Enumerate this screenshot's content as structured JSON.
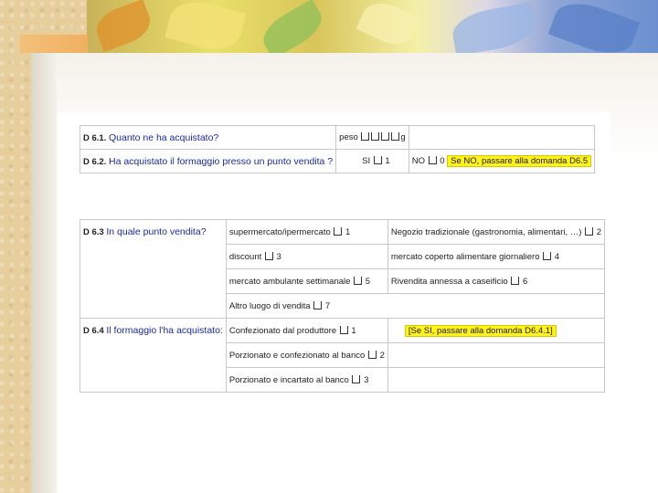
{
  "d61": {
    "code": "D 6.1.",
    "question": "Quanto ne ha acquistato?",
    "answer_label": "peso",
    "answer_unit": "g"
  },
  "d62": {
    "code": "D 6.2.",
    "question": "Ha acquistato il formaggio presso un punto vendita ?",
    "yes_label": "SI",
    "yes_code": "1",
    "no_label": "NO",
    "no_code": "0",
    "note": "Se NO, passare alla domanda D6.5"
  },
  "d63": {
    "code": "D 6.3",
    "question": "In quale punto vendita?",
    "options": [
      {
        "label": "supermercato/ipermercato",
        "code": "1"
      },
      {
        "label": "Negozio tradizionale (gastronomia, alimentari, …)",
        "code": "2"
      },
      {
        "label": "discount",
        "code": "3"
      },
      {
        "label": "mercato coperto alimentare giornaliero",
        "code": "4"
      },
      {
        "label": "mercato ambulante settimanale",
        "code": "5"
      },
      {
        "label": "Rivendita annessa a caseificio",
        "code": "6"
      },
      {
        "label": "Altro luogo di vendita",
        "code": "7"
      }
    ]
  },
  "d64": {
    "code": "D 6.4",
    "question": "Il formaggio l'ha acquistato:",
    "options": [
      {
        "label": "Confezionato dal produttore",
        "code": "1"
      },
      {
        "label": "Porzionato e confezionato al banco",
        "code": "2"
      },
      {
        "label": "Porzionato e incartato al banco",
        "code": "3"
      }
    ],
    "note": "[Se SI, passare alla domanda D6.4.1]"
  },
  "colors": {
    "question_blue": "#1a2a9a",
    "highlight_yellow": "#fff21f"
  }
}
